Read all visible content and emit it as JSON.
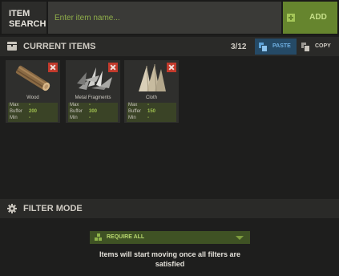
{
  "search": {
    "label": "ITEM SEARCH",
    "placeholder": "Enter item name...",
    "value": "",
    "add_label": "ADD"
  },
  "current_items": {
    "title": "CURRENT ITEMS",
    "count": "3/12",
    "paste_label": "PASTE",
    "copy_label": "COPY",
    "items": [
      {
        "name": "Wood",
        "icon": "wood-log-icon",
        "max_label": "Max",
        "max": "-",
        "buffer_label": "Buffer",
        "buffer": "200",
        "min_label": "Min",
        "min": "-"
      },
      {
        "name": "Metal Fragments",
        "icon": "metal-fragments-icon",
        "max_label": "Max",
        "max": "-",
        "buffer_label": "Buffer",
        "buffer": "300",
        "min_label": "Min",
        "min": "-"
      },
      {
        "name": "Cloth",
        "icon": "cloth-icon",
        "max_label": "Max",
        "max": "-",
        "buffer_label": "Buffer",
        "buffer": "150",
        "min_label": "Min",
        "min": "-"
      }
    ]
  },
  "filter_mode": {
    "title": "FILTER MODE",
    "selected": "REQUIRE ALL",
    "description": "Items will start moving once all filters are satisfied"
  },
  "colors": {
    "accent_green": "#66852e",
    "remove_red": "#c23a2c",
    "paste_blue": "#254a66",
    "panel_dark": "#1e1e1d"
  }
}
